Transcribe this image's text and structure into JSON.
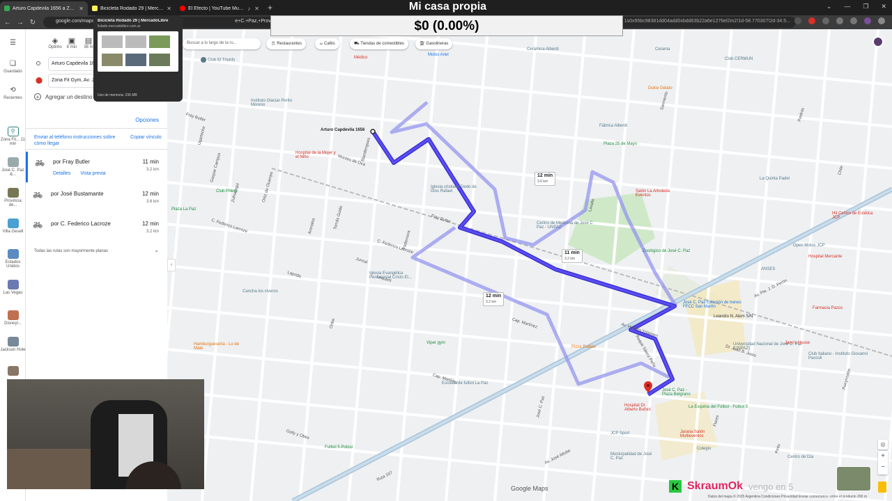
{
  "browser": {
    "tabs": [
      {
        "title": "Arturo Capdevila 1656 a Zona F...",
        "color": "#34a853",
        "active": true
      },
      {
        "title": "Bicicleta Rodado 29 | MercadoLi...",
        "color": "#fff159",
        "active": false
      },
      {
        "title": "El Efecto | YouTube Music",
        "color": "#ff0000",
        "active": false
      }
    ],
    "new_tab": "+",
    "url": "google.com/maps",
    "url_mid": "e+C.+Paz,+Provincia+de+Buenos+Aires",
    "url_tail": "1s0x95bc98381dd04add0xbdd63b22a6e1276el2m2!1d-58.770307!2d-34.5..."
  },
  "stream": {
    "title": "Mi casa propia",
    "price": "$0 (0.00%)"
  },
  "tab_preview": {
    "title": "Bicicleta Rodado 29 | MercadoLibre",
    "url": "listado.mercadolibre.com.ar",
    "memory": "Uso de memoria: 236 MB"
  },
  "rail": {
    "items": [
      {
        "label": "Guardado",
        "icon": "bookmark-icon",
        "glyph": "❏"
      },
      {
        "label": "Recientes",
        "icon": "history-icon",
        "glyph": "⟲"
      },
      {
        "label": "Zona Fit... 11 min",
        "icon": "bike-icon",
        "color": "#2a7d7d"
      },
      {
        "label": "José C. Paz &...",
        "icon": "place-thumb",
        "color": "#9aa"
      },
      {
        "label": "Provincia de...",
        "icon": "place-thumb",
        "color": "#775"
      },
      {
        "label": "Villa Gesell",
        "icon": "place-thumb",
        "color": "#4aa0d0"
      },
      {
        "label": "Estados Unidos",
        "icon": "place-thumb",
        "color": "#5a8ac0"
      },
      {
        "label": "Las Vegas",
        "icon": "place-thumb",
        "color": "#6a7ab0"
      },
      {
        "label": "Disneyl...",
        "icon": "place-thumb",
        "color": "#c07050"
      },
      {
        "label": "Jackson Hole",
        "icon": "place-thumb",
        "color": "#778899"
      },
      {
        "label": "",
        "icon": "place-thumb",
        "color": "#887766"
      }
    ]
  },
  "panel": {
    "modes": [
      {
        "label": "Óptimo",
        "glyph": "◈"
      },
      {
        "label": "8 min",
        "glyph": "🚘"
      },
      {
        "label": "36 m",
        "glyph": "🚌"
      }
    ],
    "origin": "Arturo Capdevila 16",
    "destination": "Zona Fit Gym, Av. J",
    "add_destination": "Agregar un destino",
    "options": "Opciones",
    "send_to_phone": "Enviar al teléfono instrucciones sobre cómo llegar",
    "copy_link": "Copiar vínculo",
    "routes": [
      {
        "name": "por Fray Butler",
        "time": "11 min",
        "dist": "3.2 km",
        "details": "Detalles",
        "preview": "Vista previa",
        "selected": true
      },
      {
        "name": "por José Bustamante",
        "time": "12 min",
        "dist": "3.6 km",
        "selected": false
      },
      {
        "name": "por C. Federico Lacroze",
        "time": "12 min",
        "dist": "3.2 km",
        "selected": false
      }
    ],
    "flat_note": "Todas las rutas son mayormente planas"
  },
  "map": {
    "search_placeholder": "Buscar a lo largo de la ru...",
    "chips": [
      "Restaurantes",
      "Cafés",
      "Tiendas de comestibles",
      "Gasolineras"
    ],
    "origin_label": "Arturo Capdevila 1656",
    "time_boxes": [
      {
        "time": "12 min",
        "dist": "3.6 km"
      },
      {
        "time": "11 min",
        "dist": "3.2 km"
      },
      {
        "time": "12 min",
        "dist": "3.2 km"
      }
    ],
    "streets": [
      "Fray Butler",
      "Fray Butler",
      "C. Federico Lacroze",
      "C. Federico Lacroze",
      "Juncal",
      "Laprida",
      "Laquarti",
      "Gaspar Campos",
      "Zufriategui",
      "Ortiz de Ocampo",
      "Blandengues",
      "Oribe",
      "Arenales",
      "Tomás Guido",
      "Pedernera",
      "Ugarteche",
      "Montes de Oca",
      "Cap. Martínez",
      "Cap. Martínez",
      "Av. José Altube",
      "Av. Pte. J. D. Perón",
      "Ruta 197",
      "Av. Hipólito Yrigoyen",
      "Gelly y Obes",
      "Dr. Juan B. Justo",
      "Pinto",
      "Flores",
      "José C. Paz",
      "Lavalle",
      "Roque Sáenz Peña",
      "Sarmiento",
      "Pueyrredón",
      "Piedras",
      "Chile"
    ],
    "places": [
      {
        "name": "Club El Triunfo",
        "color": "#5a7a8a"
      },
      {
        "name": "Instituto Glaciar Perito Moreno",
        "color": "#5a7a8a"
      },
      {
        "name": "Hospital de la Mujer y el Niño",
        "color": "#d93025"
      },
      {
        "name": "Club Pillero",
        "color": "#1e8e3e"
      },
      {
        "name": "Plaza La Paz",
        "color": "#1e8e3e"
      },
      {
        "name": "Iglesia cristiana Dedo de Dios Rafael",
        "color": "#5a7a8a"
      },
      {
        "name": "Centro de Medicina de José C Paz - UNPAZ",
        "color": "#5a7a8a"
      },
      {
        "name": "Plaza 25 de Mayo",
        "color": "#1e8e3e"
      },
      {
        "name": "Fábrica Alberdi",
        "color": "#5a7a8a"
      },
      {
        "name": "Dulce Gelato",
        "color": "#e8710a"
      },
      {
        "name": "Salón La Arboleda Eventos",
        "color": "#d93025"
      },
      {
        "name": "Club CERMUN",
        "color": "#5a7a8a"
      },
      {
        "name": "Cerámica Alberdi",
        "color": "#5a7a8a"
      },
      {
        "name": "Médico",
        "color": "#d93025"
      },
      {
        "name": "Motos Ariel",
        "color": "#1a73e8"
      },
      {
        "name": "Iglesia Evangélica Pentecostal Cristo El...",
        "color": "#5a7a8a"
      },
      {
        "name": "Cancha los viveros",
        "color": "#5a7a8a"
      },
      {
        "name": "Viper gym",
        "color": "#1e8e3e"
      },
      {
        "name": "Hamburguesería - Lo de Mate",
        "color": "#e8710a"
      },
      {
        "name": "Escuela de futbol La Paz",
        "color": "#5a7a8a"
      },
      {
        "name": "Futbol 5 Potosí",
        "color": "#1e8e3e"
      },
      {
        "name": "Pizza Pueblo",
        "color": "#e8710a"
      },
      {
        "name": "Hospital Dr. Alberto Bufoni",
        "color": "#d93025"
      },
      {
        "name": "José C. Paz - Plaza Belgrano",
        "color": "#1e8e3e"
      },
      {
        "name": "JCP Sport",
        "color": "#5a7a8a"
      },
      {
        "name": "Municipalidad de José C. Paz",
        "color": "#5a7a8a"
      },
      {
        "name": "Jarana Salón Multieventos",
        "color": "#d93025"
      },
      {
        "name": "José C. Paz Estación de trenes FFCC San Martín",
        "color": "#1a73e8"
      },
      {
        "name": "Leandro N. Alem S/N",
        "color": "#5a7a8a"
      },
      {
        "name": "Farmacia Pazos",
        "color": "#d93025"
      },
      {
        "name": "Universidad Nacional de José C. Paz (UNPAZ)",
        "color": "#5a7a8a"
      },
      {
        "name": "Club Italiano - Instituto Giovanni Pascoli",
        "color": "#5a7a8a"
      },
      {
        "name": "Jano's House",
        "color": "#d93025"
      },
      {
        "name": "Hospital Mercante",
        "color": "#d93025"
      },
      {
        "name": "Open Motos JCP",
        "color": "#5a7a8a"
      },
      {
        "name": "ANSES",
        "color": "#5a7a8a"
      },
      {
        "name": "Hit Centro de Estética JCP",
        "color": "#d93025"
      },
      {
        "name": "La Quinta Padel",
        "color": "#5a7a8a"
      },
      {
        "name": "Zoológico de José C. Paz",
        "color": "#1e8e3e"
      },
      {
        "name": "La Esquina del Fútbol - Fútbol 5",
        "color": "#1e8e3e"
      },
      {
        "name": "Centro de Día",
        "color": "#5a7a8a"
      },
      {
        "name": "Colegio",
        "color": "#5a7a8a"
      },
      {
        "name": "Cerama",
        "color": "#5a7a8a"
      }
    ],
    "google": "Google Maps",
    "attribution": "Datos del mapa © 2025   Argentina   Condiciones   Privacidad   Enviar comentarios sobre el producto   200 m"
  },
  "brand": {
    "logo_letter": "K",
    "name": "SkraumOk",
    "tagline": "vengo en 5"
  }
}
